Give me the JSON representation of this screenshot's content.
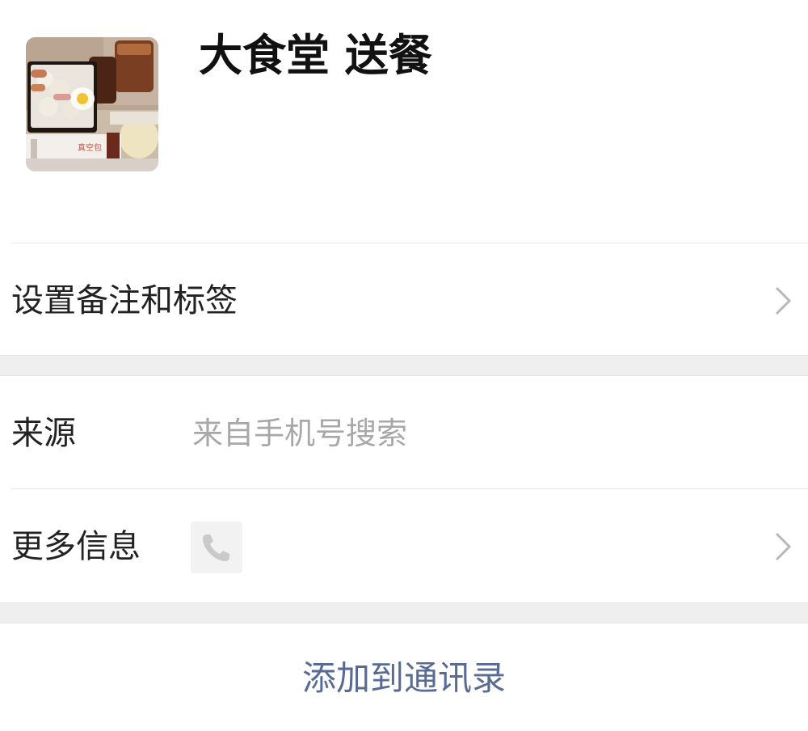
{
  "profile": {
    "name": "大食堂 送餐",
    "avatar_icon": "food-photo-avatar",
    "avatar_wrapper_text": "真空包"
  },
  "rows": {
    "remarks_tags": {
      "label": "设置备注和标签",
      "chevron_icon": "chevron-right-icon"
    },
    "source": {
      "label": "来源",
      "value": "来自手机号搜索"
    },
    "more_info": {
      "label": "更多信息",
      "phone_icon": "phone-icon",
      "chevron_icon": "chevron-right-icon"
    }
  },
  "action": {
    "add_to_contacts": "添加到通讯录"
  },
  "colors": {
    "link": "#576b95",
    "background": "#ffffff",
    "separator": "#efefef",
    "secondary_text": "#a8a8a8"
  }
}
